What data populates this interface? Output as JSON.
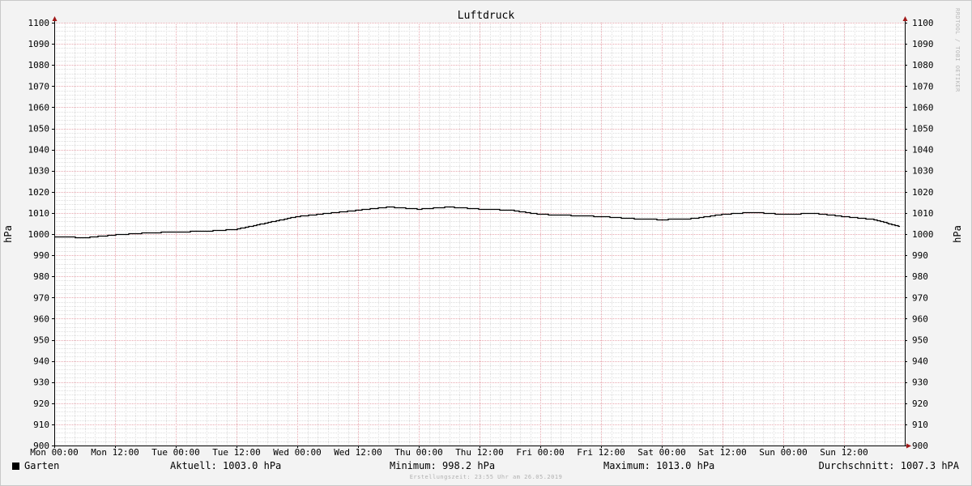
{
  "chart_data": {
    "type": "line",
    "title": "Luftdruck",
    "ylabel": "hPa",
    "ylabel_right": "hPa",
    "ylim": [
      900,
      1100
    ],
    "y_ticks": [
      "900",
      "910",
      "920",
      "930",
      "940",
      "950",
      "960",
      "970",
      "980",
      "990",
      "1000",
      "1010",
      "1020",
      "1030",
      "1040",
      "1050",
      "1060",
      "1070",
      "1080",
      "1090",
      "1100"
    ],
    "x_ticks": [
      "Mon 00:00",
      "Mon 12:00",
      "Tue 00:00",
      "Tue 12:00",
      "Wed 00:00",
      "Wed 12:00",
      "Thu 00:00",
      "Thu 12:00",
      "Fri 00:00",
      "Fri 12:00",
      "Sat 00:00",
      "Sat 12:00",
      "Sun 00:00",
      "Sun 12:00"
    ],
    "grid": true,
    "series": [
      {
        "name": "Garten",
        "color": "#000000",
        "x_hours": [
          0,
          6,
          12,
          18,
          24,
          30,
          36,
          42,
          48,
          54,
          60,
          66,
          72,
          78,
          84,
          90,
          96,
          102,
          108,
          114,
          120,
          126,
          132,
          138,
          144,
          150,
          156,
          162,
          168
        ],
        "values": [
          999.0,
          998.5,
          999.8,
          1000.7,
          1001.2,
          1001.5,
          1002.5,
          1005.5,
          1008.5,
          1010.0,
          1011.5,
          1013.0,
          1012.0,
          1013.0,
          1012.0,
          1011.5,
          1009.5,
          1009.0,
          1008.5,
          1007.5,
          1007.0,
          1007.5,
          1009.5,
          1010.5,
          1009.5,
          1010.0,
          1008.5,
          1007.0,
          1003.0
        ]
      }
    ]
  },
  "legend": {
    "series_label": "Garten",
    "current": "Aktuell: 1003.0 hPa",
    "minimum": "Minimum: 998.2 hPa",
    "maximum": "Maximum: 1013.0 hPa",
    "average": "Durchschnitt: 1007.3 hPA"
  },
  "watermark": "RRDTOOL / TOBI OETIKER",
  "footer": "Erstellungszeit: 23:55 Uhr am 26.05.2019"
}
